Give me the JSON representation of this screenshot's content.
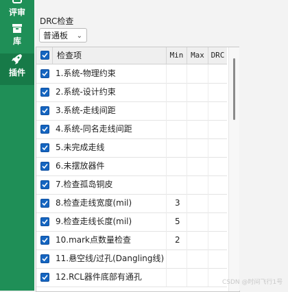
{
  "sidebar": {
    "items": [
      {
        "label": "评审",
        "icon": "review-icon"
      },
      {
        "label": "库",
        "icon": "library-icon"
      },
      {
        "label": "插件",
        "icon": "rocket-plugin-icon",
        "active": true
      }
    ]
  },
  "drc": {
    "group_label": "DRC检查",
    "preset_select": "普通板"
  },
  "table": {
    "headers": {
      "name": "检查项",
      "min": "Min",
      "max": "Max",
      "drc": "DRC"
    },
    "rows": [
      {
        "name": "1.系统-物理约束",
        "min": "",
        "max": "",
        "drc": "",
        "checked": true
      },
      {
        "name": "2.系统-设计约束",
        "min": "",
        "max": "",
        "drc": "",
        "checked": true
      },
      {
        "name": "3.系统-走线间距",
        "min": "",
        "max": "",
        "drc": "",
        "checked": true
      },
      {
        "name": "4.系统-同名走线间距",
        "min": "",
        "max": "",
        "drc": "",
        "checked": true
      },
      {
        "name": "5.未完成走线",
        "min": "",
        "max": "",
        "drc": "",
        "checked": true
      },
      {
        "name": "6.未摆放器件",
        "min": "",
        "max": "",
        "drc": "",
        "checked": true
      },
      {
        "name": "7.检查孤岛铜皮",
        "min": "",
        "max": "",
        "drc": "",
        "checked": true
      },
      {
        "name": "8.检查走线宽度(mil)",
        "min": "3",
        "max": "",
        "drc": "",
        "checked": true
      },
      {
        "name": "9.检查走线长度(mil)",
        "min": "5",
        "max": "",
        "drc": "",
        "checked": true
      },
      {
        "name": "10.mark点数量检查",
        "min": "2",
        "max": "",
        "drc": "",
        "checked": true
      },
      {
        "name": "11.悬空线/过孔(Dangling线)",
        "min": "",
        "max": "",
        "drc": "",
        "checked": true
      },
      {
        "name": "12.RCL器件底部有通孔",
        "min": "",
        "max": "",
        "drc": "",
        "checked": true
      }
    ]
  },
  "watermark": "CSDN @时间飞行1号",
  "colors": {
    "sidebar": "#1f8f57",
    "checkbox": "#1565c0"
  }
}
